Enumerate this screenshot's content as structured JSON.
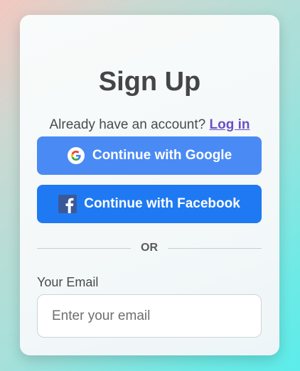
{
  "signup": {
    "title": "Sign Up",
    "login_prompt": "Already have an account?",
    "login_link": "Log in",
    "google_button": "Continue with Google",
    "facebook_button": "Continue with Facebook",
    "divider": "OR",
    "email_label": "Your Email",
    "email_placeholder": "Enter your email",
    "email_value": ""
  },
  "icons": {
    "google": "google-logo-icon",
    "facebook": "facebook-logo-icon"
  },
  "colors": {
    "google_button": "#4a8af4",
    "facebook_button": "#1f79f2",
    "link": "#6b4fc4",
    "title": "#454545"
  }
}
